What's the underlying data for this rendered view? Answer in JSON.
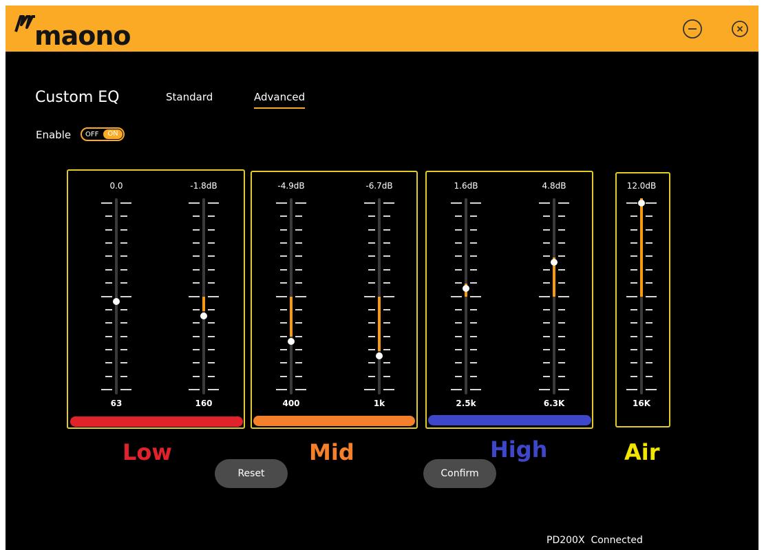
{
  "app": {
    "brand": "maono"
  },
  "window_controls": {
    "minimize_icon": "minus-circle-icon",
    "close_icon": "x-circle-icon"
  },
  "header": {
    "title": "Custom EQ",
    "tabs": [
      {
        "label": "Standard",
        "active": false
      },
      {
        "label": "Advanced",
        "active": true
      }
    ]
  },
  "enable": {
    "label": "Enable",
    "off_label": "OFF",
    "on_label": "ON",
    "state": "on"
  },
  "eq": {
    "range_db": [
      -12,
      12
    ],
    "groups": [
      {
        "name": "Low",
        "color": "#e0232b"
      },
      {
        "name": "Mid",
        "color": "#f4802b"
      },
      {
        "name": "High",
        "color": "#3e46c9"
      },
      {
        "name": "Air",
        "color": "#f3e500"
      }
    ],
    "bands": [
      {
        "freq": "63",
        "value_label": "0.0",
        "db": 0.0,
        "group": "Low"
      },
      {
        "freq": "160",
        "value_label": "-1.8dB",
        "db": -1.8,
        "group": "Low"
      },
      {
        "freq": "400",
        "value_label": "-4.9dB",
        "db": -4.9,
        "group": "Mid"
      },
      {
        "freq": "1k",
        "value_label": "-6.7dB",
        "db": -6.7,
        "group": "Mid"
      },
      {
        "freq": "2.5k",
        "value_label": "1.6dB",
        "db": 1.6,
        "group": "High"
      },
      {
        "freq": "6.3K",
        "value_label": "4.8dB",
        "db": 4.8,
        "group": "High"
      },
      {
        "freq": "16K",
        "value_label": "12.0dB",
        "db": 12.0,
        "group": "Air"
      }
    ],
    "fill_color": "#f79a10"
  },
  "actions": {
    "reset_label": "Reset",
    "confirm_label": "Confirm"
  },
  "status": {
    "device": "PD200X",
    "state": "Connected"
  },
  "colors": {
    "accent": "#fbaa25",
    "background": "#000000",
    "box_border": "#e3cc28"
  }
}
